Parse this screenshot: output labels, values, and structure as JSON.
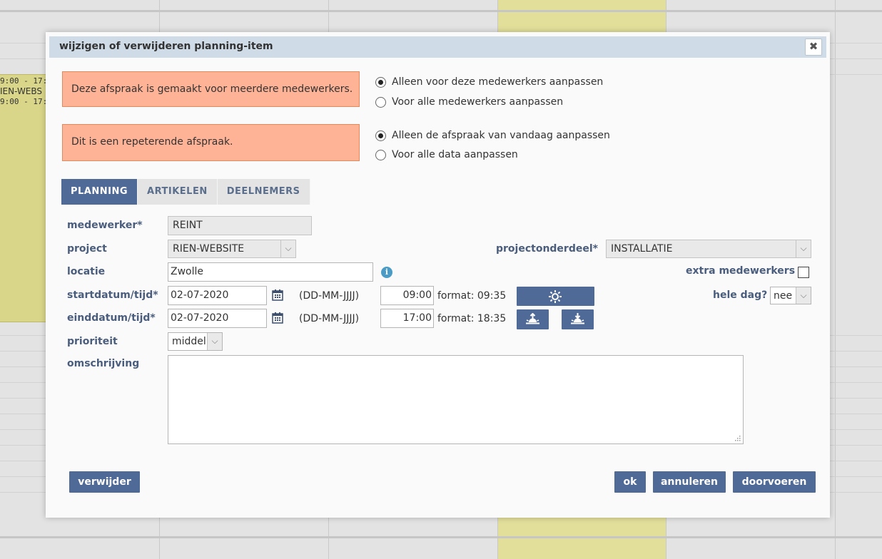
{
  "background": {
    "events": [
      "9:00 - 17:0",
      "IEN-WEBS",
      "9:00 - 17:"
    ]
  },
  "dialog": {
    "title": "wijzigen of verwijderen planning-item",
    "close_icon": "close-icon"
  },
  "notices": [
    {
      "text": "Deze afspraak is gemaakt voor meerdere medewerkers.",
      "options": [
        {
          "label": "Alleen voor deze medewerkers aanpassen",
          "checked": true
        },
        {
          "label": "Voor alle medewerkers aanpassen",
          "checked": false
        }
      ]
    },
    {
      "text": "Dit is een repeterende afspraak.",
      "options": [
        {
          "label": "Alleen de afspraak van vandaag aanpassen",
          "checked": true
        },
        {
          "label": "Voor alle data aanpassen",
          "checked": false
        }
      ]
    }
  ],
  "tabs": [
    {
      "label": "PLANNING",
      "active": true
    },
    {
      "label": "ARTIKELEN",
      "active": false
    },
    {
      "label": "DEELNEMERS",
      "active": false
    }
  ],
  "form": {
    "medewerker": {
      "label": "medewerker*",
      "value": "REINT"
    },
    "project": {
      "label": "project",
      "value": "RIEN-WEBSITE"
    },
    "projectonderdeel": {
      "label": "projectonderdeel*",
      "value": "INSTALLATIE"
    },
    "locatie": {
      "label": "locatie",
      "value": "Zwolle"
    },
    "extra_medewerkers": {
      "label": "extra medewerkers",
      "checked": false
    },
    "start": {
      "label": "startdatum/tijd*",
      "date": "02-07-2020",
      "date_format": "(DD-MM-JJJJ)",
      "time": "09:00",
      "time_hint": "format: 09:35"
    },
    "end": {
      "label": "einddatum/tijd*",
      "date": "02-07-2020",
      "date_format": "(DD-MM-JJJJ)",
      "time": "17:00",
      "time_hint": "format: 18:35"
    },
    "hele_dag": {
      "label": "hele dag?",
      "value": "nee"
    },
    "prioriteit": {
      "label": "prioriteit",
      "value": "middel"
    },
    "omschrijving": {
      "label": "omschrijving",
      "value": ""
    }
  },
  "buttons": {
    "delete": "verwijder",
    "ok": "ok",
    "cancel": "annuleren",
    "apply": "doorvoeren"
  },
  "colors": {
    "accent": "#4f6a97",
    "notice_bg": "#ffb396",
    "titlebar": "#cfdbe6",
    "label": "#4a5d7d"
  }
}
